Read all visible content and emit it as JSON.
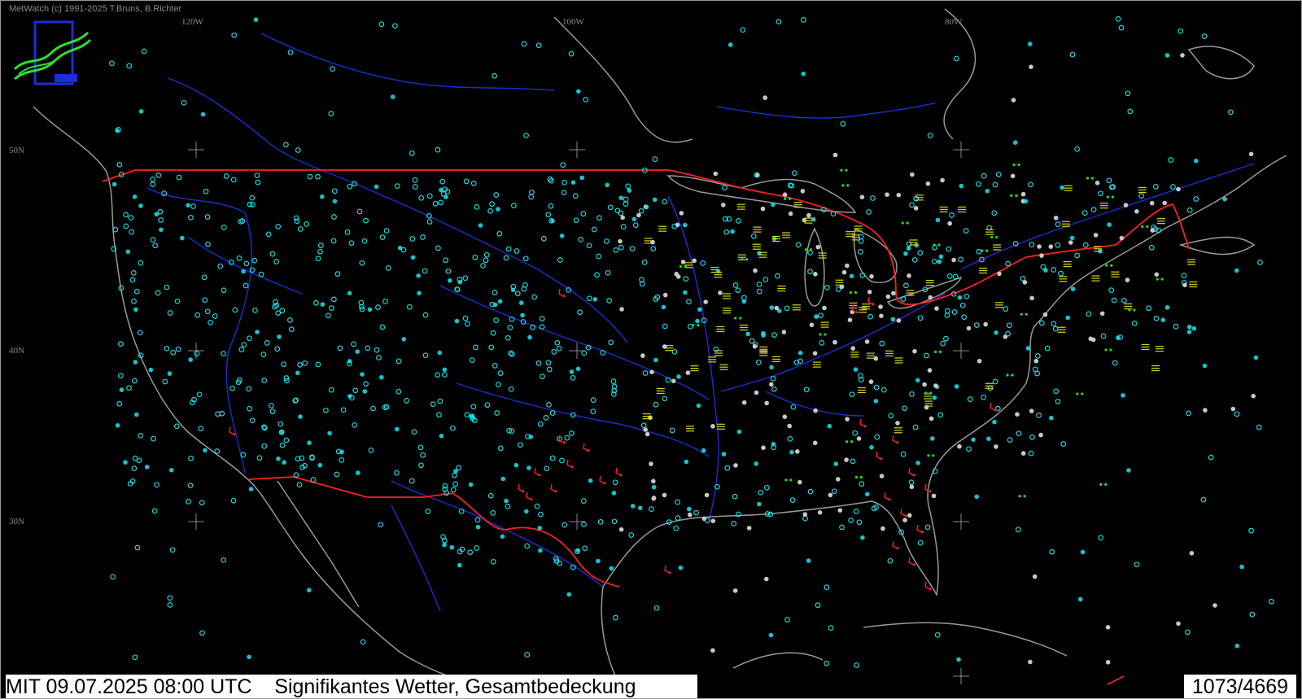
{
  "app": {
    "credit": "MetWatch  (c) 1991-2025 T.Bruns, B.Richter"
  },
  "map": {
    "longitude_labels": [
      "120W",
      "100W",
      "80W"
    ],
    "latitude_labels": [
      "50N",
      "40N",
      "30N"
    ],
    "colors": {
      "background": "#000000",
      "coastline": "#9a9a9a",
      "rivers": "#1a2fd6",
      "border": "#ff2020",
      "station_clear": "#19e6f0",
      "station_overcast": "#c8c8c8",
      "fog_symbol": "#d8d820",
      "thunderstorm_symbol": "#ff2020",
      "rain_symbol": "#20e020"
    },
    "symbols": {
      "clear_sky": "cyan-open-circle",
      "partly_cloudy": "cyan-half-circle",
      "overcast": "grey-filled-circle",
      "fog": "yellow-fog-lines",
      "haze": "yellow-double-lines",
      "thunderstorm": "red-lightning-arrow",
      "drizzle": "green-comma",
      "rain": "green-dots",
      "shower": "green-triangle"
    }
  },
  "status": {
    "left": "MIT 09.07.2025 08:00 UTC    Signifikantes Wetter, Gesamtbedeckung",
    "right": "1073/4669"
  }
}
